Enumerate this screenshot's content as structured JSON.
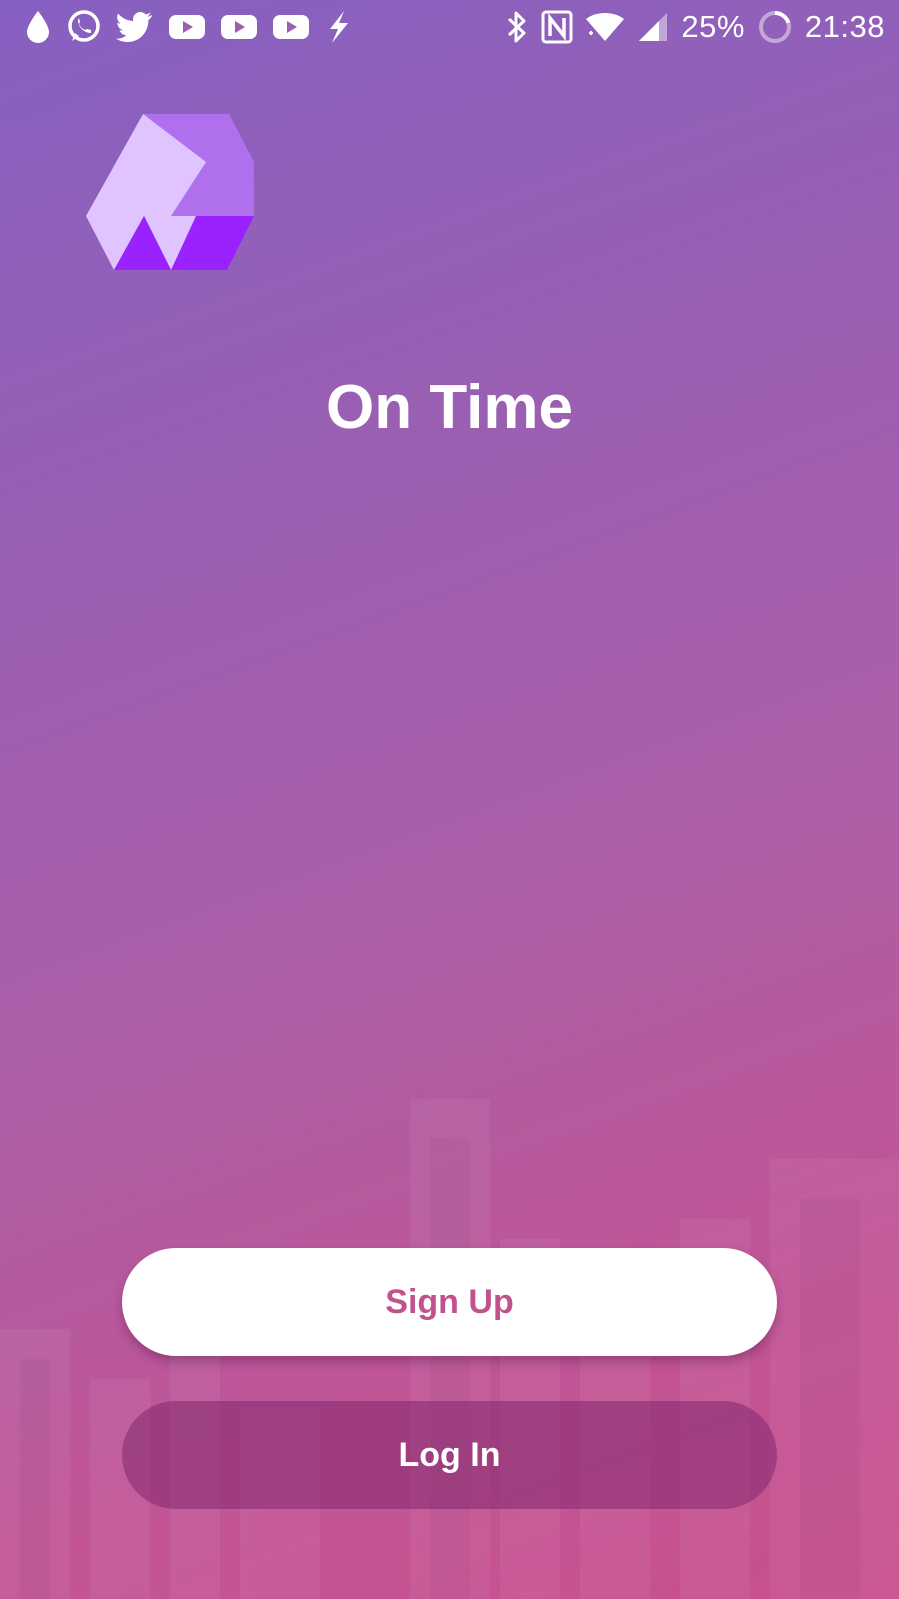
{
  "status_bar": {
    "left_icons": [
      "drop-icon",
      "whatsapp-icon",
      "twitter-icon",
      "youtube-icon",
      "youtube-icon",
      "youtube-icon",
      "flash-icon"
    ],
    "right_icons": [
      "bluetooth-icon",
      "nfc-icon",
      "wifi-icon",
      "signal-icon",
      "battery-ring-icon"
    ],
    "battery": "25%",
    "time": "21:38"
  },
  "app": {
    "title": "On Time"
  },
  "actions": {
    "sign_up_label": "Sign Up",
    "log_in_label": "Log In"
  },
  "colors": {
    "gradient_top": "#8660c2",
    "gradient_bottom": "#c9508d",
    "accent_text": "#c0528c",
    "logo_light": "#e0c4ff",
    "logo_mid": "#b070ee",
    "logo_dark": "#9a22ff"
  }
}
